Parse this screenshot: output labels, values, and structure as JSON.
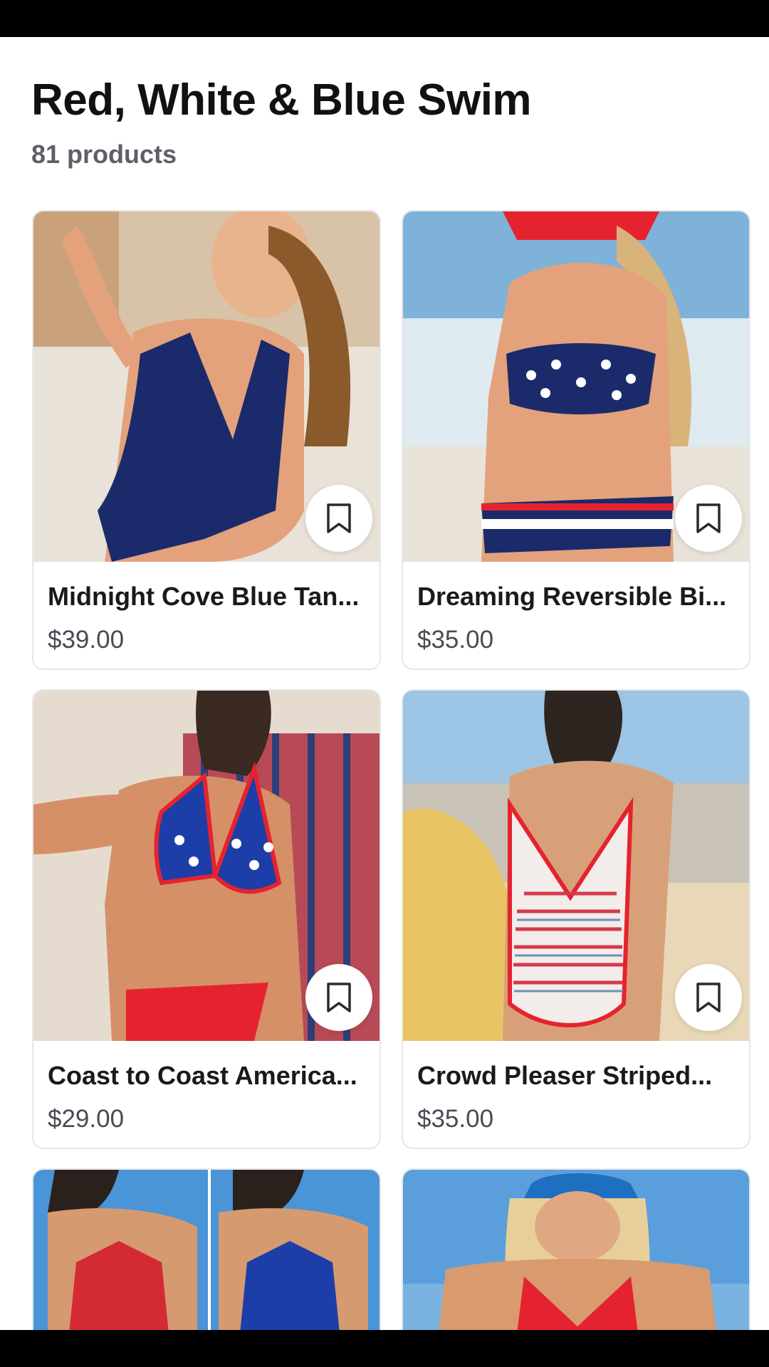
{
  "header": {
    "title": "Red, White & Blue Swim",
    "count": "81 products"
  },
  "products": [
    {
      "name": "Midnight Cove Blue Tan...",
      "price": "$39.00",
      "image_icon": "navy-one-piece-photo"
    },
    {
      "name": "Dreaming Reversible Bi...",
      "price": "$35.00",
      "image_icon": "star-bikini-photo"
    },
    {
      "name": "Coast to Coast America...",
      "price": "$29.00",
      "image_icon": "flag-triangle-bikini-photo"
    },
    {
      "name": "Crowd Pleaser Striped...",
      "price": "$35.00",
      "image_icon": "striped-one-piece-photo"
    }
  ],
  "icons": {
    "bookmark": "bookmark-icon"
  },
  "colors": {
    "navy": "#1b2a6b",
    "red": "#e5232f",
    "text_dark": "#111111",
    "text_muted": "#5f5f6b"
  }
}
